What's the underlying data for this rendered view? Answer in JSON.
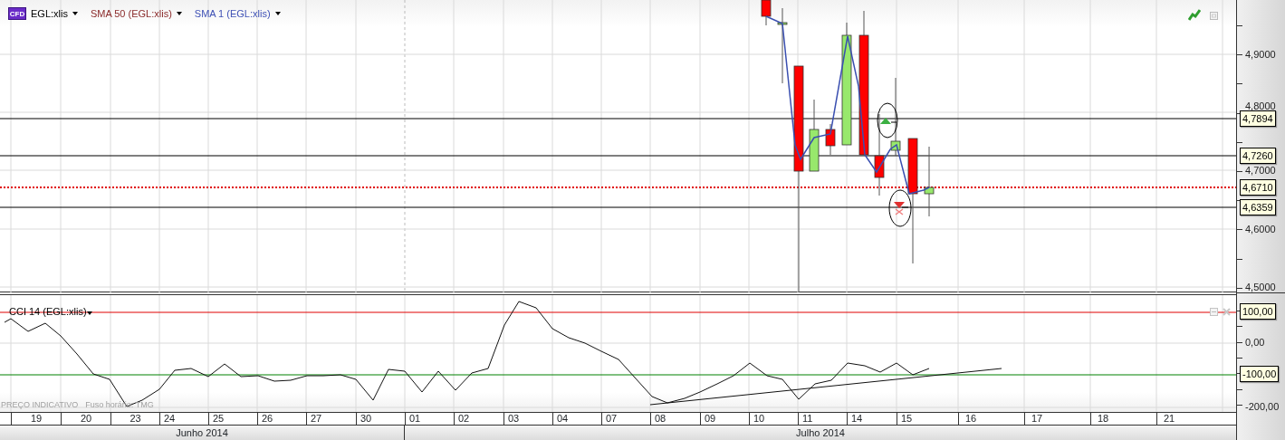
{
  "legend": {
    "badge": "CFD",
    "items": [
      {
        "label": "EGL:xlis",
        "color": "#000000"
      },
      {
        "label": "SMA 50 (EGL:xlis)",
        "color": "#8b2b2b"
      },
      {
        "label": "SMA 1 (EGL:xlis)",
        "color": "#3f51b5"
      }
    ]
  },
  "price_axis": {
    "ticks": [
      "4,9000",
      "4,8000",
      "4,7000",
      "4,6000",
      "4,5000"
    ],
    "markers": [
      {
        "label": "4,7894",
        "kind": "line"
      },
      {
        "label": "4,7260",
        "kind": "line"
      },
      {
        "label": "4,6710",
        "kind": "price"
      },
      {
        "label": "4,6359",
        "kind": "line"
      }
    ]
  },
  "indicator": {
    "label": "CCI 14 (EGL:xlis)",
    "ticks": [
      "0,00",
      "-200,00"
    ],
    "markers": [
      {
        "label": "100,00",
        "kind": "upper"
      },
      {
        "label": "-100,00",
        "kind": "lower"
      }
    ]
  },
  "footer": {
    "notice": "PREÇO INDICATIVO",
    "timezone": "Fuso horário: TMG"
  },
  "date_axis": {
    "days": [
      "19",
      "20",
      "23",
      "24",
      "25",
      "26",
      "27",
      "30",
      "01",
      "02",
      "03",
      "04",
      "07",
      "08",
      "09",
      "10",
      "11",
      "14",
      "15",
      "16",
      "17",
      "18",
      "21"
    ],
    "months": [
      "Junho 2014",
      "Julho 2014"
    ]
  }
}
